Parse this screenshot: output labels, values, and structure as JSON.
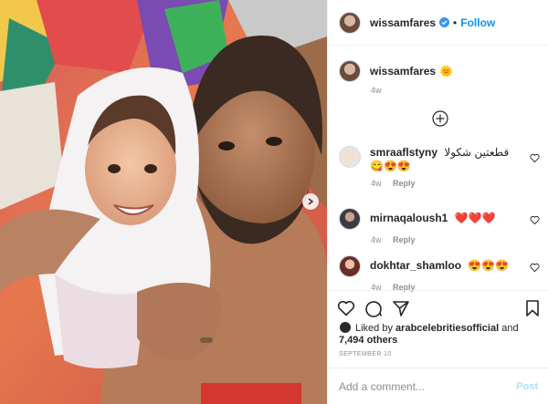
{
  "header": {
    "username": "wissamfares",
    "separator": "•",
    "follow_label": "Follow",
    "more_label": "···"
  },
  "caption": {
    "username": "wissamfares",
    "emoji": "🌞",
    "time": "4w"
  },
  "comments": [
    {
      "username": "smraaflstyny",
      "text": "قطعتين شكولا 😋😍😍",
      "time": "4w",
      "reply_label": "Reply"
    },
    {
      "username": "mirnaqaloush1",
      "text": "❤️❤️❤️",
      "time": "4w",
      "reply_label": "Reply"
    },
    {
      "username": "dokhtar_shamloo",
      "text": "😍😍😍",
      "time": "4w",
      "reply_label": "Reply"
    }
  ],
  "likes": {
    "prefix": "Liked by",
    "user": "arabcelebritiesofficial",
    "and": "and",
    "others": "7,494 others"
  },
  "date": "SEPTEMBER 10",
  "add_comment": {
    "placeholder": "Add a comment...",
    "post_label": "Post"
  },
  "icons": {
    "verified": "verified-badge-icon",
    "load_more": "plus-circle-icon",
    "like": "heart-icon",
    "comment": "comment-icon",
    "share": "paper-plane-icon",
    "save": "bookmark-icon",
    "next": "chevron-right-icon"
  },
  "colors": {
    "accent": "#0095f6",
    "muted": "#8e8e8e",
    "text": "#262626",
    "post_disabled": "#b2dffc"
  }
}
